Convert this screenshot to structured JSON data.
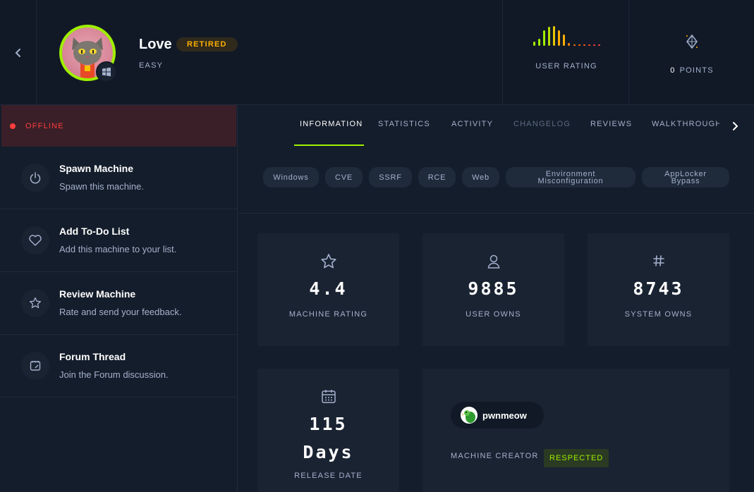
{
  "machine": {
    "name": "Love",
    "status_badge": "RETIRED",
    "difficulty": "EASY",
    "os_icon": "windows-icon"
  },
  "header": {
    "rating_label": "USER RATING",
    "points_value": "0",
    "points_label": "POINTS"
  },
  "colors": {
    "accent": "#9fef00",
    "retired": "#ffaf00",
    "offline": "#ff3e3e",
    "background": "#141d2b",
    "panel": "#1a2332"
  },
  "sidebar": {
    "status": "OFFLINE",
    "actions": [
      {
        "title": "Spawn Machine",
        "subtitle": "Spawn this machine.",
        "icon": "power-icon"
      },
      {
        "title": "Add To-Do List",
        "subtitle": "Add this machine to your list.",
        "icon": "heart-icon"
      },
      {
        "title": "Review Machine",
        "subtitle": "Rate and send your feedback.",
        "icon": "star-icon"
      },
      {
        "title": "Forum Thread",
        "subtitle": "Join the Forum discussion.",
        "icon": "forum-icon"
      }
    ]
  },
  "tabs": [
    {
      "label": "INFORMATION",
      "state": "active"
    },
    {
      "label": "STATISTICS",
      "state": "normal"
    },
    {
      "label": "ACTIVITY",
      "state": "normal"
    },
    {
      "label": "CHANGELOG",
      "state": "disabled"
    },
    {
      "label": "REVIEWS",
      "state": "normal"
    },
    {
      "label": "WALKTHROUGHS",
      "state": "normal"
    }
  ],
  "tags": [
    {
      "line1": "Windows",
      "line2": ""
    },
    {
      "line1": "CVE",
      "line2": ""
    },
    {
      "line1": "SSRF",
      "line2": ""
    },
    {
      "line1": "RCE",
      "line2": ""
    },
    {
      "line1": "Web",
      "line2": ""
    },
    {
      "line1": "Environment",
      "line2": "Misconfiguration"
    },
    {
      "line1": "AppLocker",
      "line2": "Bypass"
    }
  ],
  "stats": {
    "rating": {
      "value": "4.4",
      "label": "MACHINE RATING",
      "icon": "star-icon"
    },
    "user_owns": {
      "value": "9885",
      "label": "USER OWNS",
      "icon": "user-icon"
    },
    "system_owns": {
      "value": "8743",
      "label": "SYSTEM OWNS",
      "icon": "hash-icon"
    },
    "release": {
      "value_number": "115",
      "value_unit": "Days",
      "label": "RELEASE DATE",
      "icon": "calendar-icon"
    }
  },
  "creator": {
    "name": "pwnmeow",
    "label": "MACHINE CREATOR",
    "badge": "RESPECTED"
  }
}
